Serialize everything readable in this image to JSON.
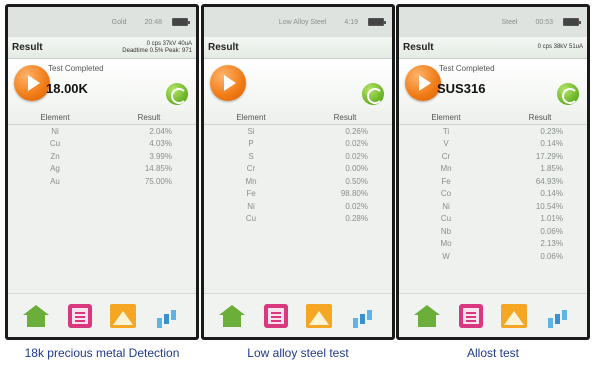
{
  "panels": [
    {
      "status_mode": "Gold",
      "status_time": "20:48",
      "result_label": "Result",
      "result_info_line1": "0 cps 37kV 40uA",
      "result_info_line2": "Deadtime 0.5% Peak: 971",
      "test_status": "Test Completed",
      "sample_name": "18.00K",
      "table_headers": [
        "Element",
        "Result"
      ],
      "rows": [
        {
          "element": "Ni",
          "result": "2.04%"
        },
        {
          "element": "Cu",
          "result": "4.03%"
        },
        {
          "element": "Zn",
          "result": "3.99%"
        },
        {
          "element": "Ag",
          "result": "14.85%"
        },
        {
          "element": "Au",
          "result": "75.00%"
        }
      ],
      "caption": "18k precious metal Detection"
    },
    {
      "status_mode": "Low Alloy Steel",
      "status_time": "4:19",
      "result_label": "Result",
      "result_info_line1": "",
      "result_info_line2": "",
      "test_status": "",
      "sample_name": "",
      "table_headers": [
        "Element",
        "Result"
      ],
      "rows": [
        {
          "element": "Si",
          "result": "0.26%"
        },
        {
          "element": "P",
          "result": "0.02%"
        },
        {
          "element": "S",
          "result": "0.02%"
        },
        {
          "element": "Cr",
          "result": "0.00%"
        },
        {
          "element": "Mn",
          "result": "0.50%"
        },
        {
          "element": "Fe",
          "result": "98.80%"
        },
        {
          "element": "Ni",
          "result": "0.02%"
        },
        {
          "element": "Cu",
          "result": "0.28%"
        }
      ],
      "caption": "Low alloy steel test"
    },
    {
      "status_mode": "Steel",
      "status_time": "00:53",
      "result_label": "Result",
      "result_info_line1": "0 cps 38kV 51uA",
      "result_info_line2": "",
      "test_status": "Test Completed",
      "sample_name": "SUS316",
      "table_headers": [
        "Element",
        "Result"
      ],
      "rows": [
        {
          "element": "Ti",
          "result": "0.23%"
        },
        {
          "element": "V",
          "result": "0.14%"
        },
        {
          "element": "Cr",
          "result": "17.29%"
        },
        {
          "element": "Mn",
          "result": "1.85%"
        },
        {
          "element": "Fe",
          "result": "64.93%"
        },
        {
          "element": "Co",
          "result": "0.14%"
        },
        {
          "element": "Ni",
          "result": "10.54%"
        },
        {
          "element": "Cu",
          "result": "1.01%"
        },
        {
          "element": "Nb",
          "result": "0.06%"
        },
        {
          "element": "Mo",
          "result": "2.13%"
        },
        {
          "element": "W",
          "result": "0.06%"
        }
      ],
      "caption": "Allost test"
    }
  ],
  "icons": {
    "play": "play-icon",
    "refresh": "refresh-icon",
    "home": "home-icon",
    "report": "report-icon",
    "spectrum": "spectrum-icon",
    "chart": "bar-chart-icon"
  },
  "colors": {
    "play_orange": "#f07a14",
    "refresh_green": "#6eb82a",
    "caption_blue": "#1f3a8a"
  }
}
